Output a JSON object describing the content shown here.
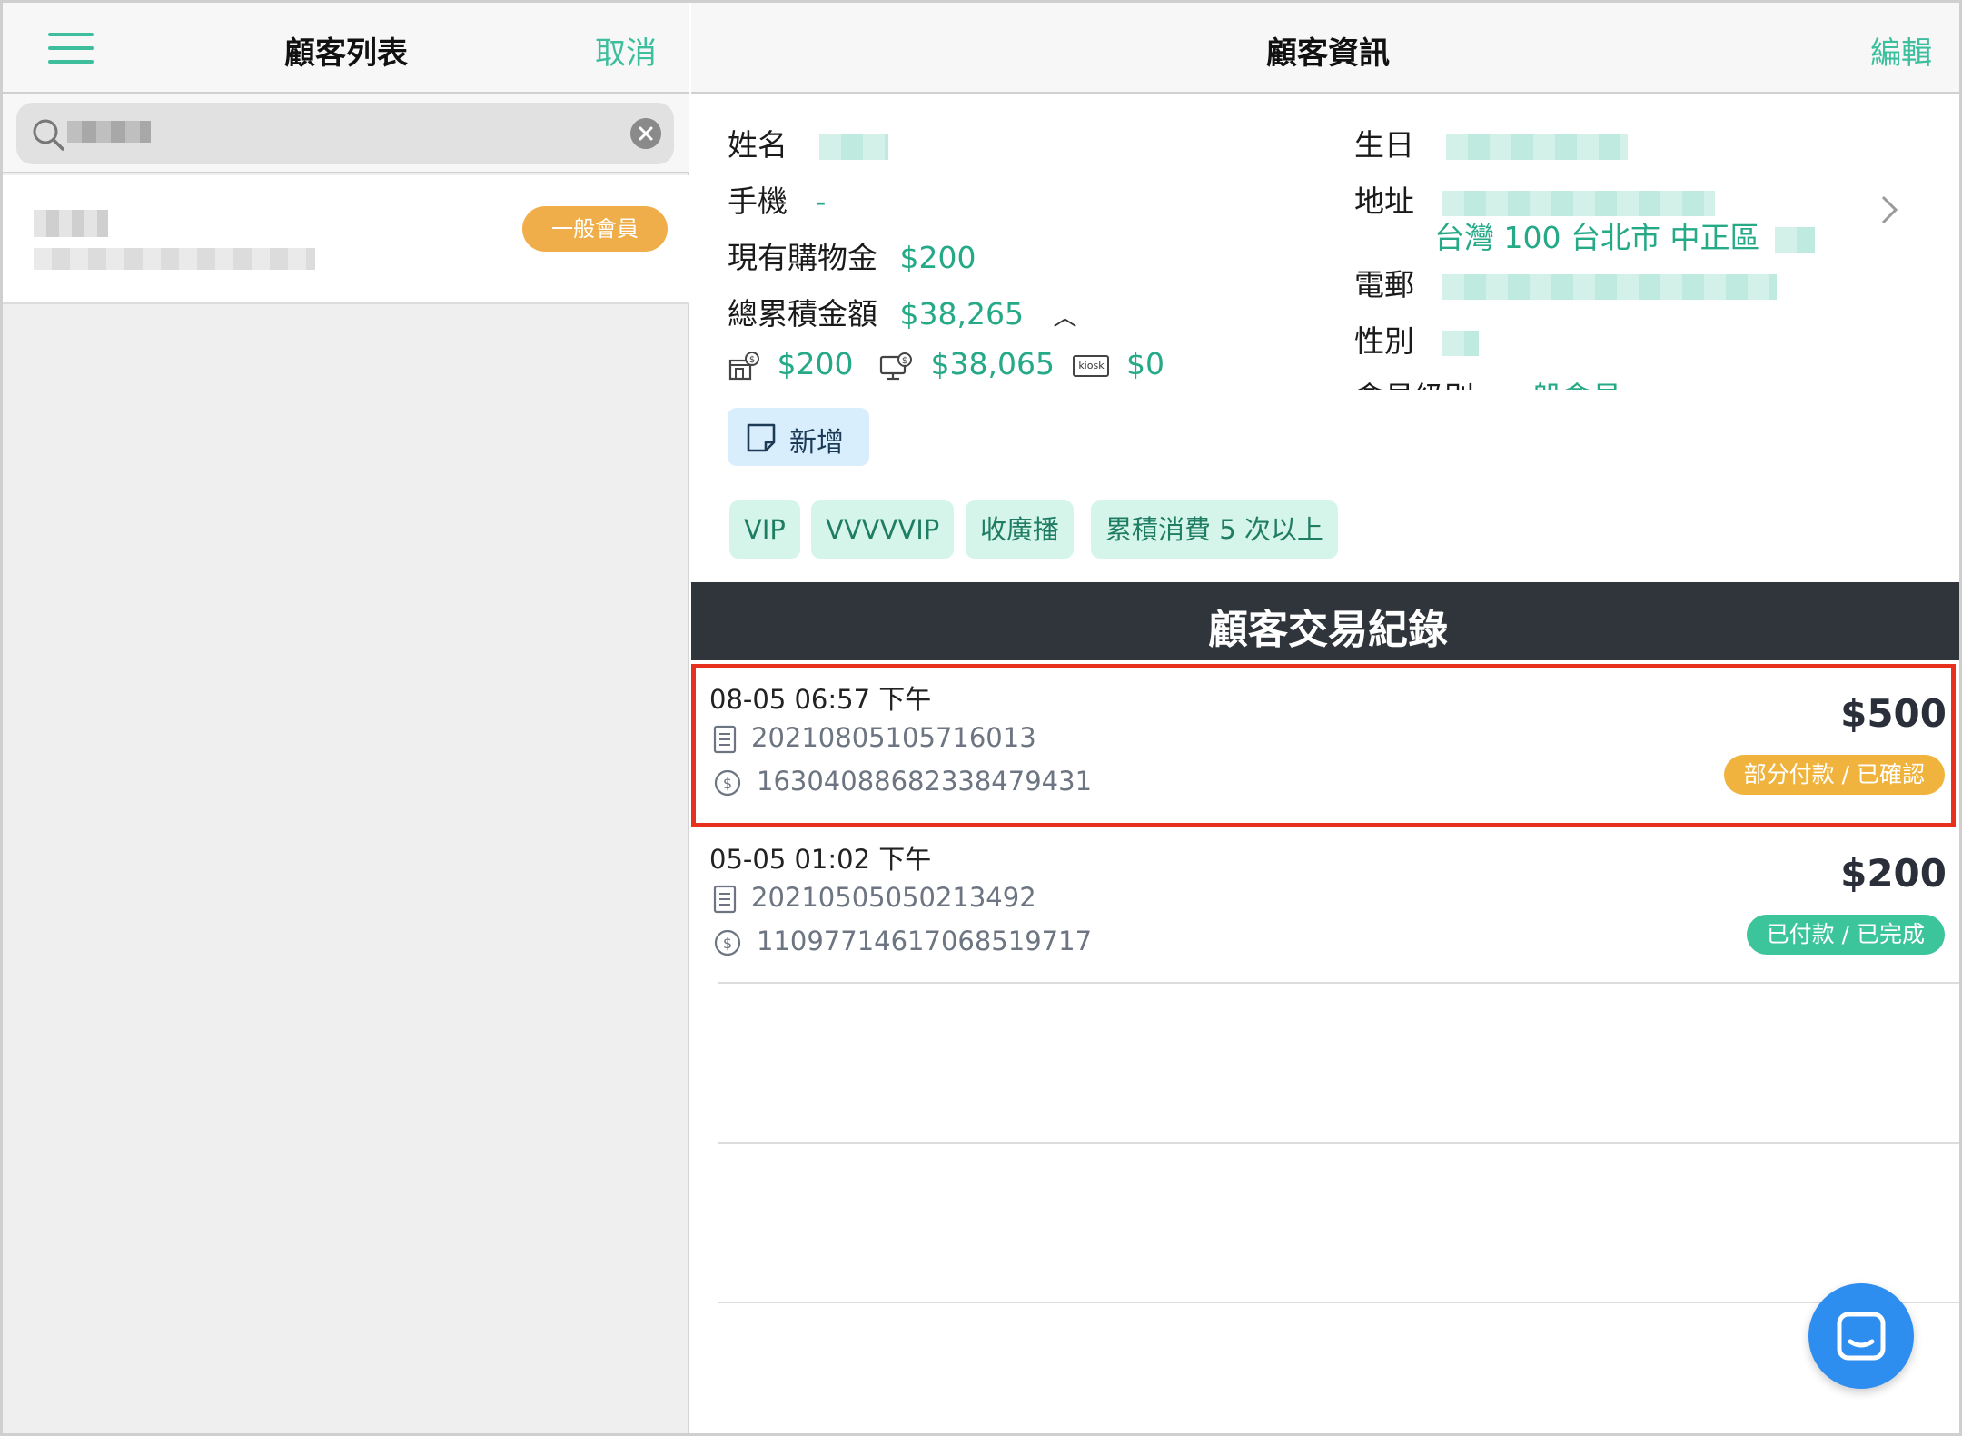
{
  "left_panel": {
    "title": "顧客列表",
    "cancel_label": "取消",
    "customer": {
      "badge": "一般會員"
    }
  },
  "right_panel": {
    "title": "顧客資訊",
    "edit_label": "編輯",
    "info": {
      "name_label": "姓名",
      "phone_label": "手機",
      "phone_value": "-",
      "credit_label": "現有購物金",
      "credit_value": "$200",
      "total_label": "總累積金額",
      "total_value": "$38,265",
      "breakdown": {
        "store": "$200",
        "online": "$38,065",
        "kiosk": "$0",
        "kiosk_icon_text": "kiosk"
      },
      "birthday_label": "生日",
      "address_label": "地址",
      "address_value": "台灣 100 台北市 中正區",
      "email_label": "電郵",
      "gender_label": "性別",
      "member_level_label": "會員級別",
      "member_level_value": "一般會員"
    },
    "add_note_label": "新增",
    "tags": [
      "VIP",
      "VVVVVIP",
      "收廣播",
      "累積消費 5 次以上"
    ],
    "section_title": "顧客交易紀錄",
    "transactions": [
      {
        "datetime": "08-05 06:57 下午",
        "order_no": "20210805105716013",
        "payment_no": "16304088682338479431",
        "amount": "$500",
        "status": "部分付款 / 已確認",
        "status_color": "#f0b43e"
      },
      {
        "datetime": "05-05 01:02 下午",
        "order_no": "20210505050213492",
        "payment_no": "11097714617068519717",
        "amount": "$200",
        "status": "已付款 / 已完成",
        "status_color": "#3cc49a"
      }
    ]
  },
  "colors": {
    "accent": "#3dbf9e",
    "highlight": "#e8301e",
    "section_bar": "#2f353b",
    "fab": "#2e8ef0"
  }
}
